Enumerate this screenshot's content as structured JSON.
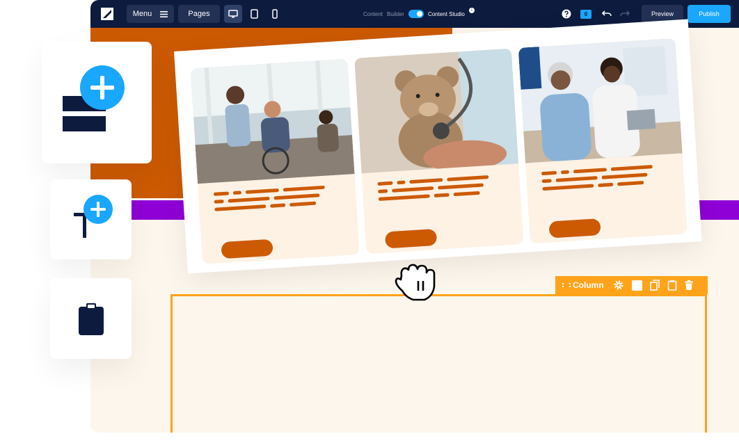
{
  "topbar": {
    "menu_label": "Menu",
    "pages_label": "Pages",
    "content_builder_label": "Content",
    "builder_label": "Builder",
    "content_studio_label": "Content Studio",
    "info_badge": "i",
    "counter": "0",
    "preview_label": "Preview",
    "publish_label": "Publish"
  },
  "icons": {
    "logo": "app-logo",
    "hamburger": "hamburger-icon",
    "desktop": "desktop-icon",
    "tablet": "tablet-icon",
    "mobile": "mobile-icon",
    "help": "help-icon",
    "comment": "comment-icon",
    "undo": "undo-icon",
    "redo": "redo-icon",
    "plus": "plus-icon",
    "clipboard": "clipboard-icon",
    "grab_hand": "grab-hand-icon"
  },
  "column_toolbar": {
    "label": "Column"
  },
  "colors": {
    "topbar": "#0d1b3e",
    "accent_blue": "#1aa7ff",
    "brand_orange": "#cc5a03",
    "purple": "#8f00d6",
    "selection_orange": "#ffa31a",
    "canvas": "#fdf6ec"
  }
}
